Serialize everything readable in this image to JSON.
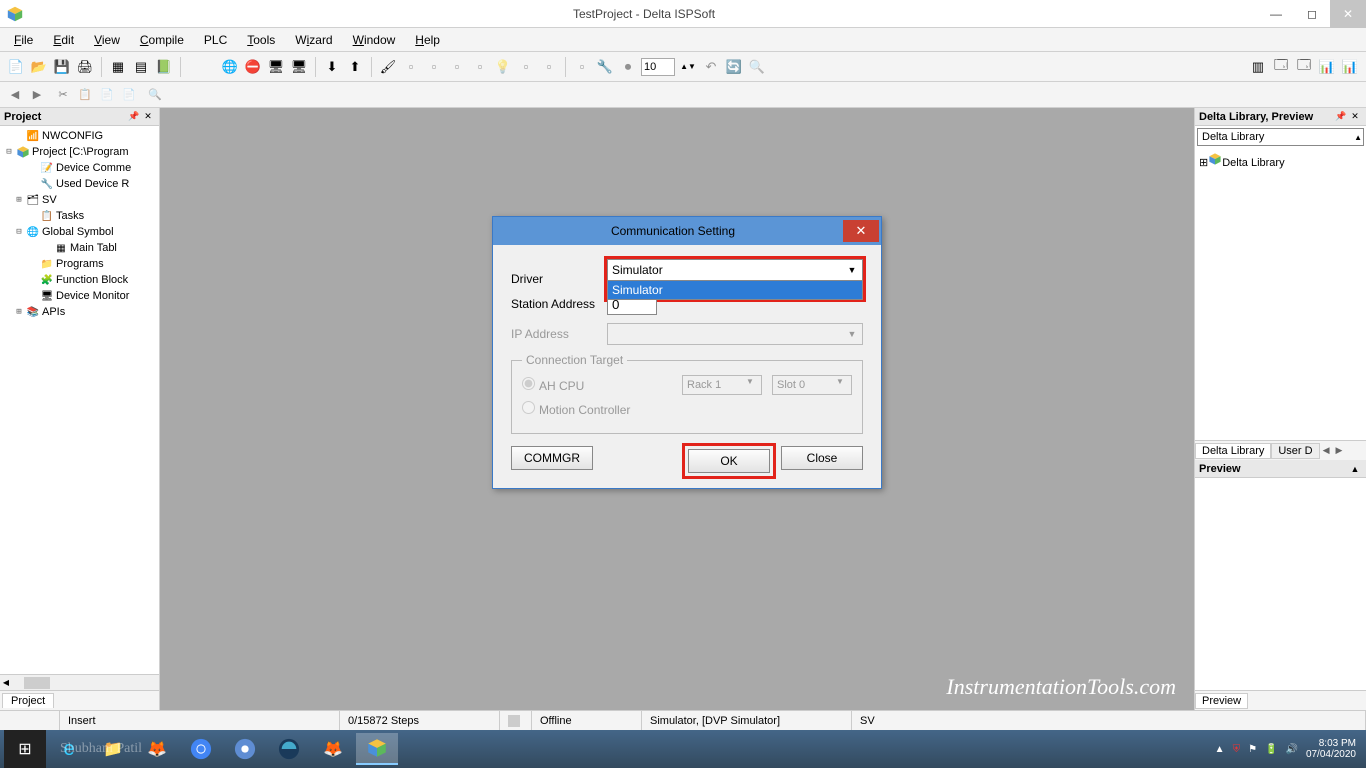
{
  "window": {
    "title": "TestProject - Delta ISPSoft"
  },
  "menu": {
    "file": "File",
    "edit": "Edit",
    "view": "View",
    "compile": "Compile",
    "plc": "PLC",
    "tools": "Tools",
    "wizard": "Wizard",
    "window": "Window",
    "help": "Help"
  },
  "toolbar": {
    "number_value": "10"
  },
  "project_panel": {
    "title": "Project",
    "tab": "Project",
    "tree": {
      "nwconfig": "NWCONFIG",
      "project_root": "Project [C:\\Program",
      "device_comment": "Device Comme",
      "used_device": "Used Device R",
      "sv": "SV",
      "tasks": "Tasks",
      "global_symbol": "Global Symbol",
      "main_tab": "Main Tabl",
      "programs": "Programs",
      "function_block": "Function Block",
      "device_monitor": "Device Monitor",
      "apis": "APIs"
    }
  },
  "dialog": {
    "title": "Communication Setting",
    "driver_label": "Driver",
    "driver_value": "Simulator",
    "driver_option": "Simulator",
    "station_label": "Station Address",
    "station_value": "0",
    "ip_label": "IP Address",
    "connection_target": "Connection Target",
    "ah_cpu": "AH CPU",
    "rack": "Rack 1",
    "slot": "Slot 0",
    "motion": "Motion Controller",
    "commgr": "COMMGR",
    "ok": "OK",
    "close": "Close"
  },
  "library_panel": {
    "header": "Delta Library, Preview",
    "combo": "Delta Library",
    "tree_root": "Delta Library",
    "tab1": "Delta Library",
    "tab2": "User D",
    "preview_header": "Preview",
    "preview_tab": "Preview"
  },
  "status": {
    "insert": "Insert",
    "steps": "0/15872 Steps",
    "offline": "Offline",
    "simulator": "Simulator, [DVP Simulator]",
    "sv": "SV"
  },
  "taskbar": {
    "time": "8:03 PM",
    "date": "07/04/2020"
  },
  "watermark": "InstrumentationTools.com"
}
